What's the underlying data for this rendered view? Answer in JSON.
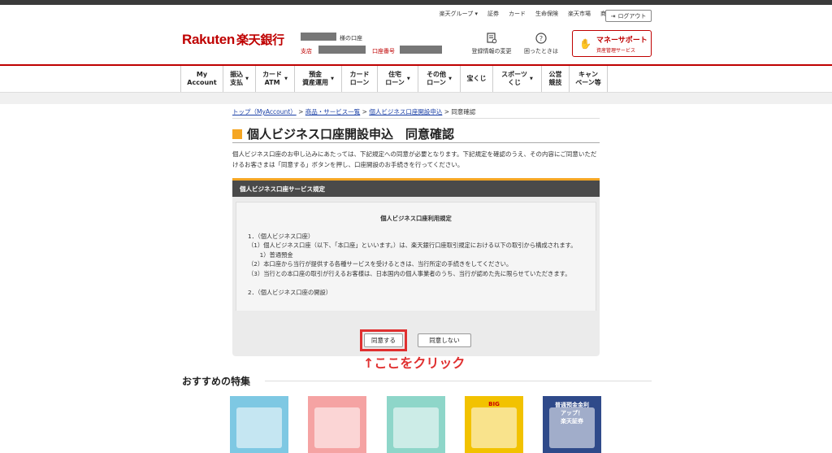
{
  "header": {
    "util_links": [
      "楽天グループ ▾",
      "証券",
      "カード",
      "生命保険",
      "楽天市場",
      "商品・サービス一覧"
    ],
    "logout_label": "ログアウト",
    "logo_text": "Rakuten",
    "logo_jp": "楽天銀行",
    "account_suffix": "様の口座",
    "branch_label": "支店",
    "account_no_label": "口座番号",
    "reg_change_label": "登録情報の変更",
    "help_label": "困ったときは",
    "money_support_title": "マネーサポート",
    "money_support_sub": "資産管理サービス"
  },
  "nav": {
    "items": [
      {
        "label": "My\nAccount",
        "arrow": false
      },
      {
        "label": "振込\n支払",
        "arrow": true
      },
      {
        "label": "カード\nATM",
        "arrow": true
      },
      {
        "label": "預金\n資産運用",
        "arrow": true
      },
      {
        "label": "カード\nローン",
        "arrow": false
      },
      {
        "label": "住宅\nローン",
        "arrow": true
      },
      {
        "label": "その他\nローン",
        "arrow": true
      },
      {
        "label": "宝くじ",
        "arrow": false
      },
      {
        "label": "スポーツ\nくじ",
        "arrow": true
      },
      {
        "label": "公営\n競技",
        "arrow": false
      },
      {
        "label": "キャン\nペーン等",
        "arrow": false
      }
    ]
  },
  "breadcrumb": {
    "top": "トップ（MyAccount）",
    "services": "商品・サービス一覧",
    "apply": "個人ビジネス口座開設申込",
    "current": "同意確認",
    "sep": " > "
  },
  "page": {
    "title": "個人ビジネス口座開設申込　同意確認",
    "intro": "個人ビジネス口座のお申し込みにあたっては、下記規定への同意が必要となります。下記規定を確認のうえ、その内容にご同意いただけるお客さまは「同意する」ボタンを押し、口座開設のお手続きを行ってください。",
    "terms_header": "個人ビジネス口座サービス規定",
    "terms_title": "個人ビジネス口座利用規定",
    "terms_lines": [
      "1．（個人ビジネス口座）",
      "（1）個人ビジネス口座（以下、「本口座」といいます。）は、楽天銀行口座取引規定における以下の取引から構成されます。",
      "　　1）普通預金",
      "（2）本口座から当行が提供する各種サービスを受けるときは、当行所定の手続きをしてください。",
      "（3）当行との本口座の取引が行えるお客様は、日本国内の個人事業者のうち、当行が認めた先に限らせていただきます。",
      "",
      "2．（個人ビジネス口座の開設）"
    ],
    "agree_label": "同意する",
    "disagree_label": "同意しない",
    "click_note": "↑ここをクリック"
  },
  "recommend": {
    "title": "おすすめの特集",
    "items": [
      {
        "name": "calendar-feature",
        "caption": "",
        "color": "#7ec8e3"
      },
      {
        "name": "shopping-feature",
        "caption": "",
        "color": "#f5a3a3"
      },
      {
        "name": "card-feature",
        "caption": "",
        "color": "#8ed6c9"
      },
      {
        "name": "sports-lottery-feature",
        "caption": "BIG",
        "color": "#f2c200"
      },
      {
        "name": "securities-feature",
        "caption": "普通預金金利\nアップ！\n楽天証券",
        "color": "#2f4a8a"
      }
    ]
  }
}
